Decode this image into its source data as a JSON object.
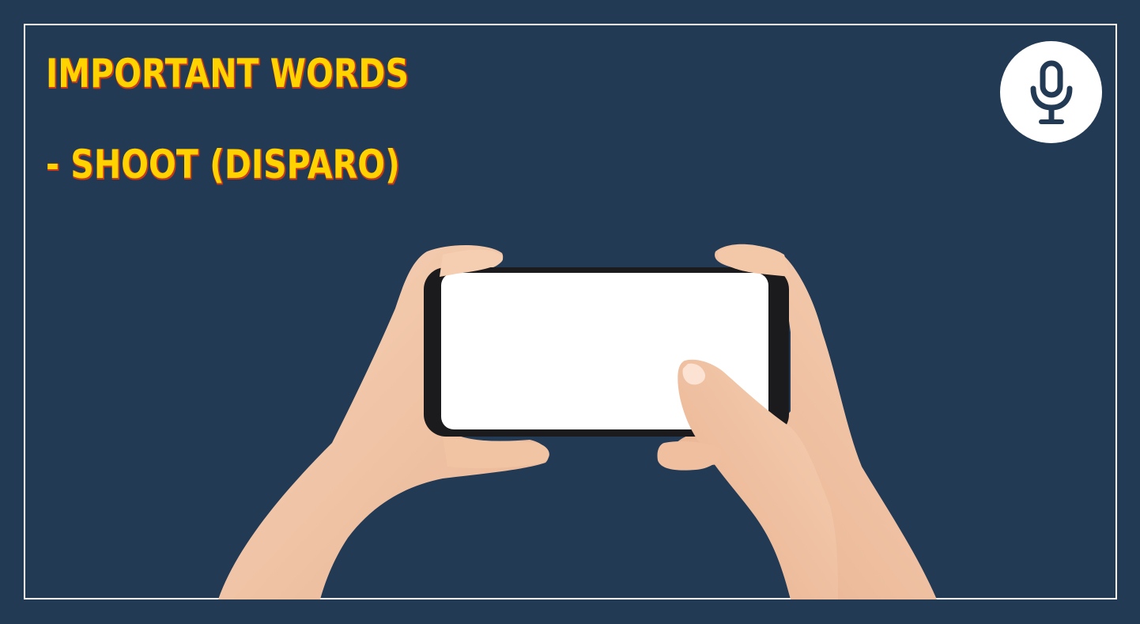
{
  "slide": {
    "title": "IMPORTANT WORDS",
    "word": "- SHOOT (DISPARO)"
  },
  "icons": {
    "mic": "microphone-icon"
  },
  "colors": {
    "background": "#233a55",
    "frame": "#ffffff",
    "text": "#ffd200",
    "text_shadow": "#c8381a",
    "mic_button": "#ffffff",
    "mic_glyph": "#233a55",
    "skin": "#f3c6a6",
    "phone_body": "#1b1b1d",
    "phone_screen": "#ffffff"
  }
}
